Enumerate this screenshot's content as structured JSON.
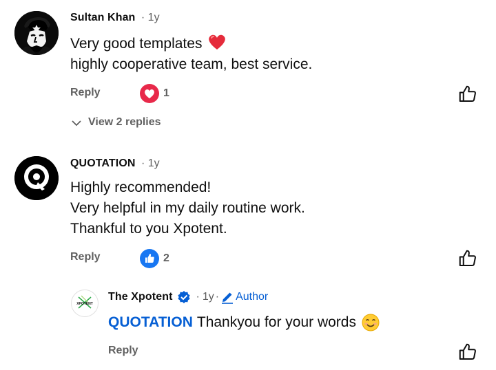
{
  "comments": [
    {
      "author": "Sultan Khan",
      "dot": "·",
      "age": "1y",
      "lines": [
        "Very good templates",
        "highly cooperative team, best service."
      ],
      "reply_label": "Reply",
      "reaction_count": "1",
      "view_replies_label": "View 2 replies"
    },
    {
      "author": "QUOTATION",
      "dot": "·",
      "age": "1y",
      "lines": [
        "Highly recommended!",
        "Very helpful in my daily routine work.",
        "Thankful to you Xpotent."
      ],
      "reply_label": "Reply",
      "reaction_count": "2"
    }
  ],
  "reply": {
    "author": "The Xpotent",
    "dot1": "·",
    "age": "1y",
    "dot2": "·",
    "author_badge": "Author",
    "mention": "QUOTATION",
    "text": "Thankyou for your words",
    "reply_label": "Reply",
    "avatar_logo_text": "XPOTENT"
  },
  "icons": [
    "heart-emoji-icon",
    "heart-reaction-icon",
    "like-reaction-icon",
    "thumbs-up-icon",
    "chevron-down-icon",
    "verified-icon",
    "pencil-icon",
    "smile-emoji-icon"
  ],
  "colors": {
    "link_blue": "#065fd4",
    "heart_red": "#e8294a",
    "like_blue": "#1877f2",
    "meta_gray": "#606060"
  }
}
